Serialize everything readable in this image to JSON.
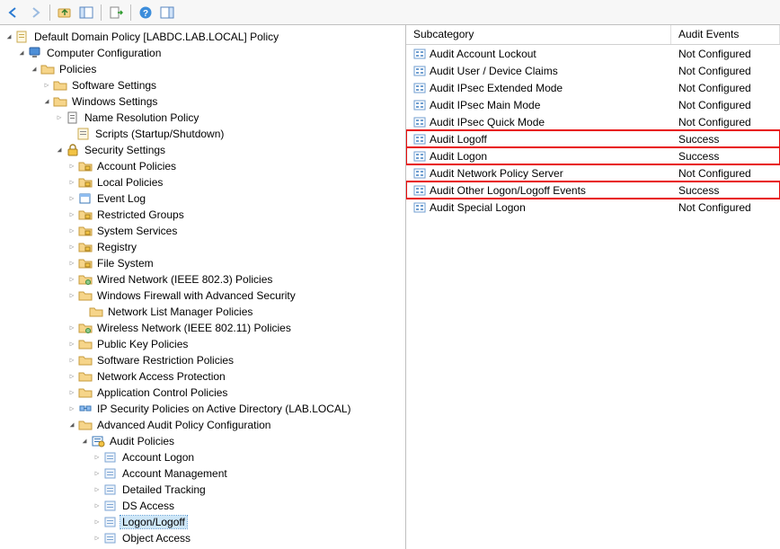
{
  "toolbar": {
    "back": "back-icon",
    "forward": "forward-icon",
    "up": "folder-up-icon",
    "show": "show-hide-tree-icon",
    "export": "export-icon",
    "help": "help-icon",
    "action": "show-hide-action-icon"
  },
  "tree": {
    "root": "Default Domain Policy [LABDC.LAB.LOCAL] Policy",
    "computer_config": "Computer Configuration",
    "policies": "Policies",
    "software_settings": "Software Settings",
    "windows_settings": "Windows Settings",
    "name_resolution": "Name Resolution Policy",
    "scripts": "Scripts (Startup/Shutdown)",
    "security_settings": "Security Settings",
    "sec": {
      "account_policies": "Account Policies",
      "local_policies": "Local Policies",
      "event_log": "Event Log",
      "restricted_groups": "Restricted Groups",
      "system_services": "System Services",
      "registry": "Registry",
      "file_system": "File System",
      "wired_network": "Wired Network (IEEE 802.3) Policies",
      "firewall": "Windows Firewall with Advanced Security",
      "netlist": "Network List Manager Policies",
      "wireless_network": "Wireless Network (IEEE 802.11) Policies",
      "pubkey": "Public Key Policies",
      "software_restriction": "Software Restriction Policies",
      "nap": "Network Access Protection",
      "app_control": "Application Control Policies",
      "ipsec": "IP Security Policies on Active Directory (LAB.LOCAL)",
      "advanced_audit": "Advanced Audit Policy Configuration"
    },
    "audit_policies": "Audit Policies",
    "audit": {
      "account_logon": "Account Logon",
      "account_mgmt": "Account Management",
      "detailed_tracking": "Detailed Tracking",
      "ds_access": "DS Access",
      "logon_logoff": "Logon/Logoff",
      "object_access": "Object Access"
    }
  },
  "list": {
    "header_subcategory": "Subcategory",
    "header_audit_events": "Audit Events",
    "rows": [
      {
        "name": "Audit Account Lockout",
        "events": "Not Configured",
        "hl": false
      },
      {
        "name": "Audit User / Device Claims",
        "events": "Not Configured",
        "hl": false
      },
      {
        "name": "Audit IPsec Extended Mode",
        "events": "Not Configured",
        "hl": false
      },
      {
        "name": "Audit IPsec Main Mode",
        "events": "Not Configured",
        "hl": false
      },
      {
        "name": "Audit IPsec Quick Mode",
        "events": "Not Configured",
        "hl": false
      },
      {
        "name": "Audit Logoff",
        "events": "Success",
        "hl": true
      },
      {
        "name": "Audit Logon",
        "events": "Success",
        "hl": true
      },
      {
        "name": "Audit Network Policy Server",
        "events": "Not Configured",
        "hl": false
      },
      {
        "name": "Audit Other Logon/Logoff Events",
        "events": "Success",
        "hl": true
      },
      {
        "name": "Audit Special Logon",
        "events": "Not Configured",
        "hl": false
      }
    ]
  },
  "colors": {
    "highlight_border": "#e80c0c",
    "selection_bg": "#cde6f7"
  }
}
